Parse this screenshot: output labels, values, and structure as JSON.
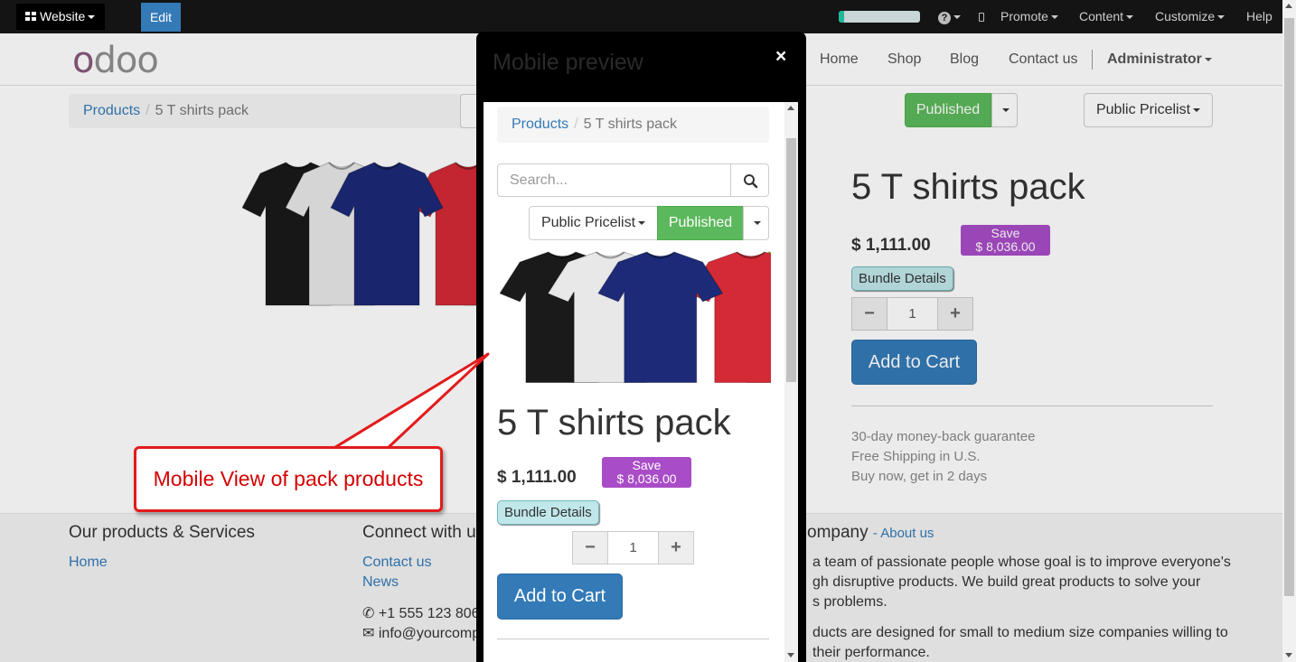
{
  "topbar": {
    "website_label": "Website",
    "edit_label": "Edit",
    "progress": 0.07,
    "promote_label": "Promote",
    "content_label": "Content",
    "customize_label": "Customize",
    "help_label": "Help"
  },
  "navbar": {
    "logo_first": "o",
    "logo_rest": "doo",
    "links": [
      "Home",
      "Shop",
      "Blog",
      "Contact us"
    ],
    "admin_label": "Administrator"
  },
  "breadcrumb": {
    "parent": "Products",
    "current": "5 T shirts pack"
  },
  "controls": {
    "published_label": "Published",
    "pricelist_label": "Public Pricelist"
  },
  "product": {
    "title": "5 T shirts pack",
    "price": "$ 1,111.00",
    "save_label": "Save",
    "save_amount": "$ 8,036.00",
    "bundle_label": "Bundle Details",
    "quantity": "1",
    "add_to_cart": "Add to Cart",
    "benefits": [
      "30-day money-back guarantee",
      "Free Shipping in U.S.",
      "Buy now, get in 2 days"
    ],
    "shirt_colors": [
      "#1a1a1a",
      "#e8e8e8",
      "#1c2a78",
      "#d42a36",
      "#f2d51e"
    ]
  },
  "footer": {
    "col1_title": "Our products & Services",
    "col1_links": [
      "Home"
    ],
    "col2_title": "Connect with u",
    "col2_links": [
      "Contact us",
      "News"
    ],
    "col2_phone": "+1 555 123 806",
    "col2_email": "info@yourcomp",
    "col3_title": "ompany",
    "col3_about": "- About us",
    "col3_lines": [
      "a team of passionate people whose goal is to improve everyone's",
      "gh disruptive products. We build great products to solve your",
      "s problems.",
      "ducts are designed for small to medium size companies willing to",
      "their performance."
    ]
  },
  "modal": {
    "title": "Mobile preview",
    "close": "×",
    "search_placeholder": "Search..."
  },
  "callout": {
    "text": "Mobile View of pack products",
    "color": "#e21b1b"
  }
}
